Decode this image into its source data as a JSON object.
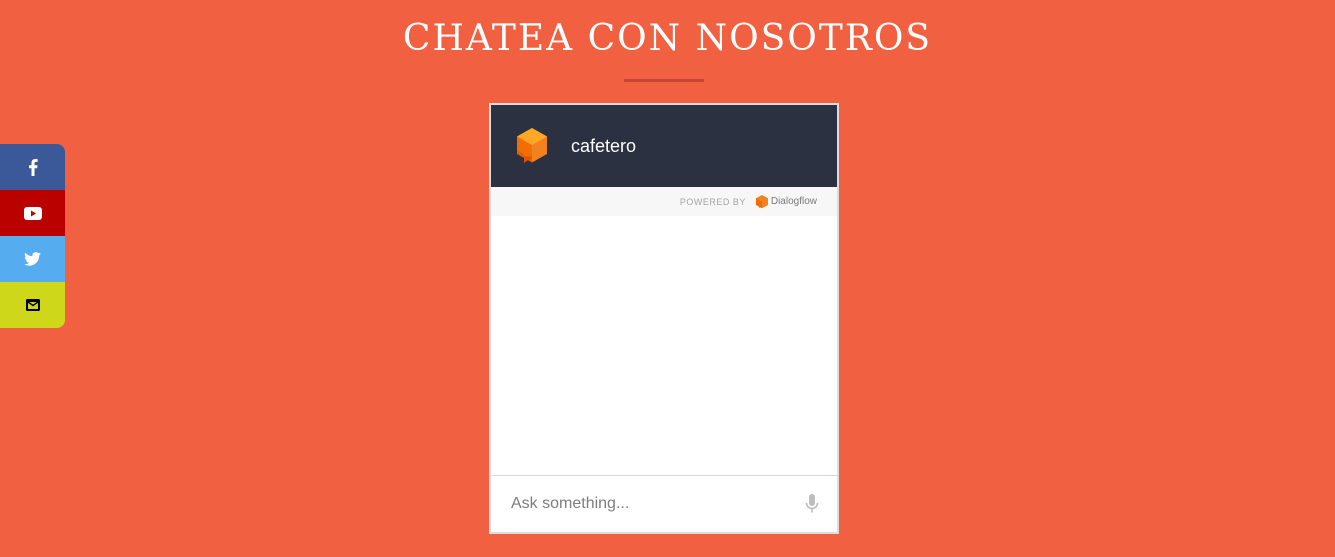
{
  "page": {
    "title": "CHATEA CON NOSOTROS"
  },
  "social": {
    "items": [
      {
        "name": "facebook",
        "icon": "facebook-icon",
        "color": "#3b5998"
      },
      {
        "name": "youtube",
        "icon": "youtube-icon",
        "color": "#bb0000"
      },
      {
        "name": "twitter",
        "icon": "twitter-icon",
        "color": "#55acee"
      },
      {
        "name": "email",
        "icon": "envelope-icon",
        "color": "#cfd71a"
      }
    ]
  },
  "chat": {
    "bot_name": "cafetero",
    "powered_by": "POWERED BY",
    "brand": "Dialogflow",
    "input_placeholder": "Ask something...",
    "input_value": "",
    "mic_icon": "microphone-icon"
  },
  "colors": {
    "background": "#f06041",
    "header": "#2b3140",
    "bot_icon": "#f48120"
  }
}
